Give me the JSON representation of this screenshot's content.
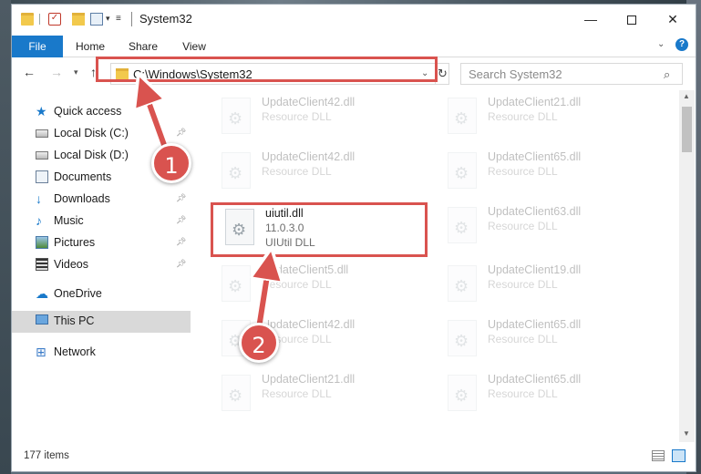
{
  "window": {
    "title": "System32",
    "minimize": "—",
    "close": "✕"
  },
  "ribbon": {
    "tabs": [
      "File",
      "Home",
      "Share",
      "View"
    ],
    "help": "?"
  },
  "navigation": {
    "address": "C:\\Windows\\System32",
    "search_placeholder": "Search System32"
  },
  "sidebar": {
    "items": [
      {
        "label": "Quick access",
        "icon": "quick-access-star-icon"
      },
      {
        "label": "Local Disk (C:)",
        "icon": "disk-icon",
        "pinned": true
      },
      {
        "label": "Local Disk (D:)",
        "icon": "disk-icon"
      },
      {
        "label": "Documents",
        "icon": "documents-icon"
      },
      {
        "label": "Downloads",
        "icon": "downloads-icon",
        "pinned": true
      },
      {
        "label": "Music",
        "icon": "music-icon",
        "pinned": true
      },
      {
        "label": "Pictures",
        "icon": "pictures-icon",
        "pinned": true
      },
      {
        "label": "Videos",
        "icon": "videos-icon",
        "pinned": true
      },
      {
        "label": "OneDrive",
        "icon": "onedrive-icon"
      },
      {
        "label": "This PC",
        "icon": "this-pc-icon",
        "selected": true
      },
      {
        "label": "Network",
        "icon": "network-icon"
      }
    ]
  },
  "files": {
    "left": [
      {
        "name": "UpdateClient42.dll",
        "desc": "Resource DLL"
      },
      {
        "name": "UpdateClient42.dll",
        "desc": "Resource DLL"
      },
      {
        "name": "uiutil.dll",
        "version": "11.0.3.0",
        "desc": "UIUtil DLL"
      },
      {
        "name": "UpdateClient5.dll",
        "desc": "Resource DLL"
      },
      {
        "name": "UpdateClient42.dll",
        "desc": "Resource DLL"
      },
      {
        "name": "UpdateClient21.dll",
        "desc": "Resource DLL"
      }
    ],
    "right": [
      {
        "name": "UpdateClient21.dll",
        "desc": "Resource DLL"
      },
      {
        "name": "UpdateClient65.dll",
        "desc": "Resource DLL"
      },
      {
        "name": "UpdateClient63.dll",
        "desc": "Resource DLL"
      },
      {
        "name": "UpdateClient19.dll",
        "desc": "Resource DLL"
      },
      {
        "name": "UpdateClient65.dll",
        "desc": "Resource DLL"
      },
      {
        "name": "UpdateClient65.dll",
        "desc": "Resource DLL"
      }
    ]
  },
  "status": {
    "item_count": "177 items"
  },
  "callouts": {
    "step1": "1",
    "step2": "2"
  },
  "colors": {
    "accent": "#1979ca",
    "callout_red": "#d9534f"
  }
}
